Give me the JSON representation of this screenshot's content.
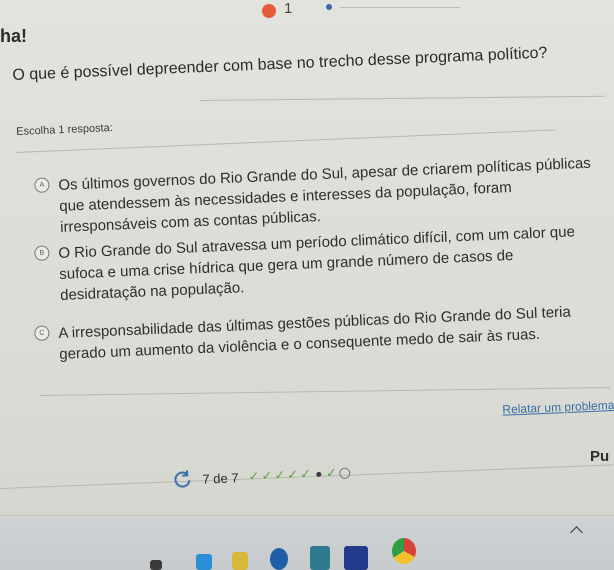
{
  "header": {
    "fragment_text": "ha!",
    "progress_number": "1"
  },
  "question": {
    "text": "O que é possível depreender com base no trecho desse programa político?",
    "instruction": "Escolha 1 resposta:"
  },
  "options": [
    {
      "letter": "A",
      "text": "Os últimos governos do Rio Grande do Sul, apesar de criarem políticas públicas que atendessem às necessidades e interesses da população, foram irresponsáveis com as contas públicas."
    },
    {
      "letter": "B",
      "text": "O Rio Grande do Sul atravessa um período climático difícil, com um calor que sufoca e uma crise hídrica que gera um grande número de casos de desidratação na população."
    },
    {
      "letter": "C",
      "text": "A irresponsabilidade das últimas gestões públicas do Rio Grande do Sul teria gerado um aumento da violência e o consequente medo de sair às ruas."
    }
  ],
  "footer": {
    "report_link": "Relatar um problema",
    "next_fragment": "Pu",
    "progress_count": "7 de 7",
    "progress_completed": 6,
    "progress_total": 7
  },
  "colors": {
    "accent_link": "#3a6fa8",
    "check_green": "#5aa845"
  },
  "taskbar": {
    "icons": [
      "file-icon",
      "folder-icon",
      "app-icon",
      "app-icon",
      "store-icon",
      "app-icon",
      "chrome-icon",
      "chevron-up-icon"
    ]
  }
}
